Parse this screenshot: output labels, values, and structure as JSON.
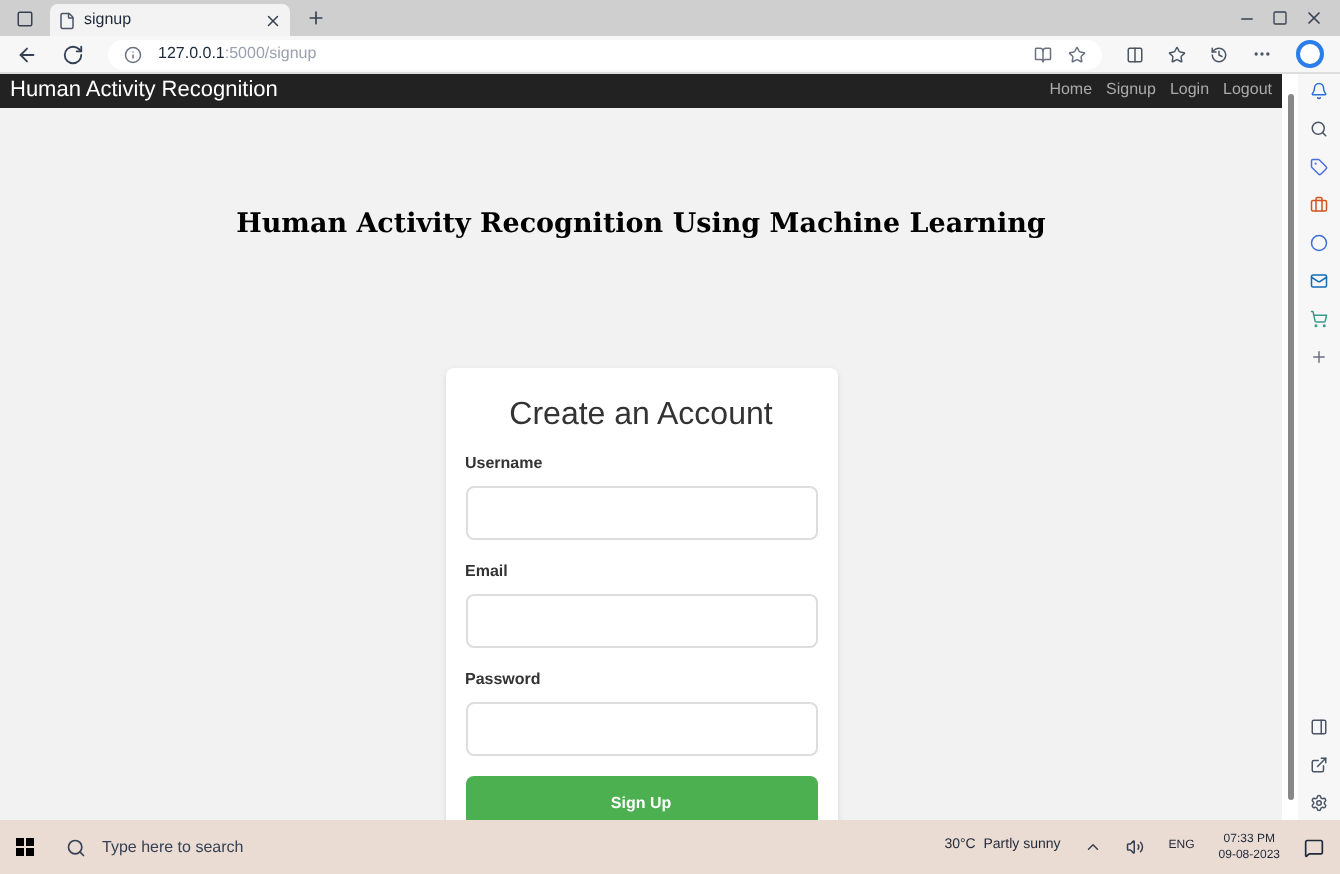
{
  "browser": {
    "tab_title": "signup",
    "url_host": "127.0.0.1",
    "url_path": ":5000/signup"
  },
  "navbar": {
    "brand": "Human Activity Recognition",
    "links": [
      "Home",
      "Signup",
      "Login",
      "Logout"
    ]
  },
  "heading": "Human Activity Recognition Using Machine Learning",
  "form": {
    "title": "Create an Account",
    "fields": [
      {
        "label": "Username"
      },
      {
        "label": "Email"
      },
      {
        "label": "Password"
      }
    ],
    "submit": "Sign Up"
  },
  "taskbar": {
    "search_placeholder": "Type here to search",
    "weather": "30°C  Partly sunny",
    "language": "ENG",
    "time": "07:33 PM",
    "date": "09-08-2023"
  }
}
